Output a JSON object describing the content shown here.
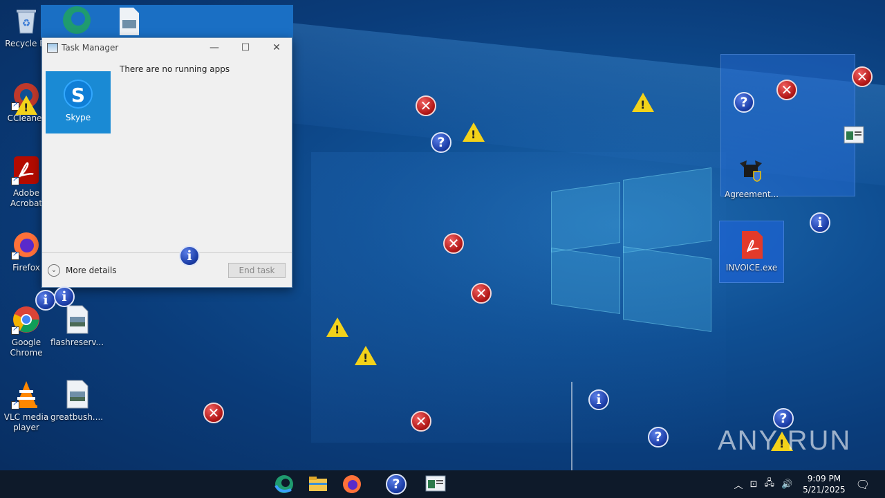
{
  "desktop": {
    "icons": [
      {
        "label": "Recycle Bin",
        "shown": "Recycle Bi"
      },
      {
        "label": "CCleaner"
      },
      {
        "label": "Adobe Acrobat"
      },
      {
        "label": "Firefox"
      },
      {
        "label": "Google Chrome"
      },
      {
        "label": "flashreserv..."
      },
      {
        "label": "VLC media player"
      },
      {
        "label": "greatbush...."
      },
      {
        "label": "Agreement..."
      },
      {
        "label": "INVOICE.exe"
      }
    ]
  },
  "task_manager": {
    "title": "Task Manager",
    "empty_message": "There are no running apps",
    "app_tile_label": "Skype",
    "more_details": "More details",
    "end_task": "End task"
  },
  "taskbar": {
    "time": "9:09 PM",
    "date": "5/21/2025"
  },
  "watermark": "ANY RUN"
}
